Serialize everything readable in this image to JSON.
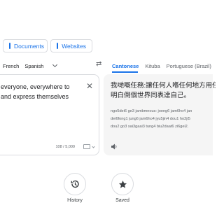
{
  "mode_tabs": {
    "documents_label": "Documents",
    "websites_label": "Websites"
  },
  "source": {
    "languages": [
      "French",
      "Spanish"
    ],
    "text_lines": [
      "everyone, everywhere to",
      "and express themselves"
    ],
    "char_count": "108 / 5,000"
  },
  "swap_label": "⇄",
  "target": {
    "languages": [
      "Cantonese",
      "Kituba",
      "Portuguese (Brazil)"
    ],
    "text_lines": [
      "我哋嘅任務:讓任何人喺任何地方用任",
      "明白倒個世界同表達自己。"
    ],
    "romanization_lines": [
      "ngo5dei6 ge3 jambmnous: joeng6 jam6ho4 jan",
      "dei6fong1 jung6 jam6ho4 jyu5jin4 dou1 ho2ji5",
      "dou2 go3 sai3gaai3 tung4 biu2daat6 zi6gei2."
    ]
  },
  "bottom": {
    "history_label": "History",
    "saved_label": "Saved"
  },
  "colors": {
    "accent": "#1a73e8",
    "border": "#dadce0",
    "panel_bg": "#f5f5f5",
    "muted": "#5f6368"
  }
}
